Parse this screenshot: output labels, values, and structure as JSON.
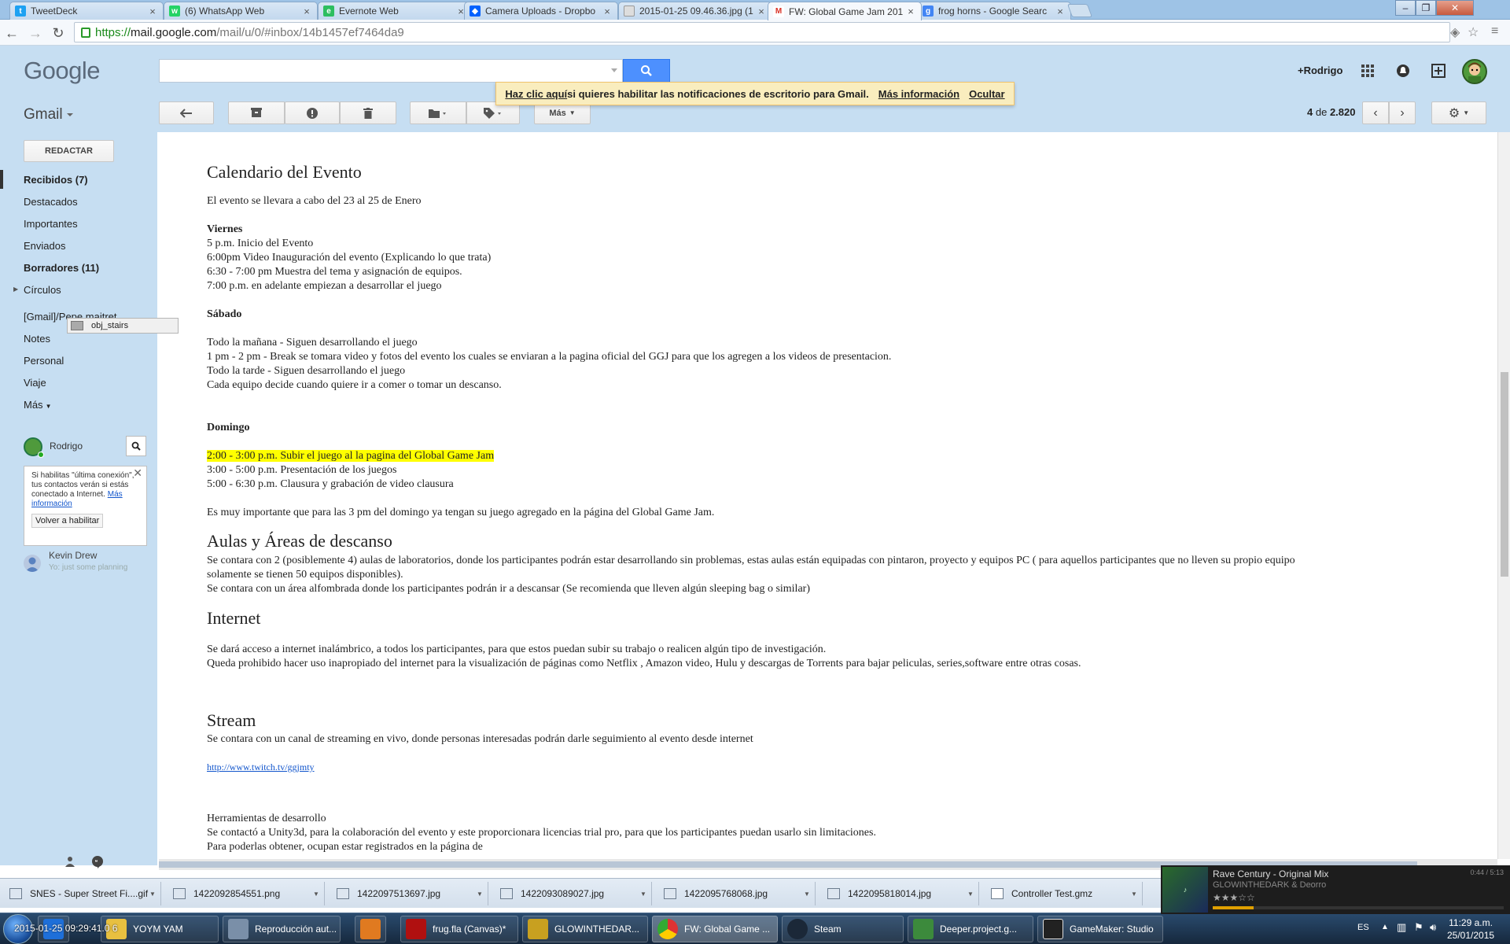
{
  "browser": {
    "tabs": [
      {
        "title": "TweetDeck",
        "icon": "twitter-icon",
        "color": "#1da1f2"
      },
      {
        "title": "(6) WhatsApp Web",
        "icon": "whatsapp-icon",
        "color": "#25d366"
      },
      {
        "title": "Evernote Web",
        "icon": "evernote-icon",
        "color": "#2dbe60"
      },
      {
        "title": "Camera Uploads - Dropbo",
        "icon": "dropbox-icon",
        "color": "#0061fe"
      },
      {
        "title": "2015-01-25 09.46.36.jpg (1",
        "icon": "document-icon",
        "color": "#999999"
      },
      {
        "title": "FW: Global Game Jam 201",
        "icon": "gmail-icon",
        "color": "#d93025"
      },
      {
        "title": "frog horns - Google Searc",
        "icon": "google-icon",
        "color": "#4285f4"
      }
    ],
    "url_scheme": "https://",
    "url_host": "mail.google.com",
    "url_path": "/mail/u/0/#inbox/14b1457ef7464da9"
  },
  "gmail": {
    "logo": "Google",
    "app_label": "Gmail",
    "user": "+Rodrigo",
    "notification": {
      "link": "Haz clic aquí",
      "text": " si quieres habilitar las notificaciones de escritorio para Gmail.",
      "more": "Más información",
      "hide": "Ocultar"
    },
    "more_label": "Más",
    "page_pos": "4",
    "page_of": "de",
    "page_total": "2.820",
    "compose": "REDACTAR",
    "nav": [
      "Recibidos (7)",
      "Destacados",
      "Importantes",
      "Enviados",
      "Borradores (11)",
      "Círculos",
      "[Gmail]/Pepe.maitret...",
      "Notes",
      "Personal",
      "Viaje",
      "Más"
    ],
    "chat_user": "Rodrigo",
    "tooltip": "obj_stairs",
    "chat_popup": {
      "text": "Si habilitas \"última conexión\", tus contactos verán si estás conectado a Internet.",
      "link": "Más información",
      "button": "Volver a habilitar"
    },
    "contact_name": "Kevin Drew",
    "contact_status": "Yo: just some planning"
  },
  "message": {
    "h_calendario": "Calendario del Evento",
    "p_fechas": "El evento se llevara a cabo del 23 al 25 de Enero",
    "viernes": "Viernes",
    "viernes_lines": [
      "5 p.m.  Inicio del Evento",
      "6:00pm  Video Inauguración del evento (Explicando lo que trata)",
      "6:30 -  7:00 pm  Muestra del tema y asignación de equipos.",
      "7:00 p.m. en adelante empiezan a desarrollar el juego"
    ],
    "sabado": "Sábado",
    "sabado_lines": [
      "Todo la mañana - Siguen desarrollando el juego",
      "1 pm - 2 pm -  Break se tomara video y fotos del evento los cuales se enviaran a la pagina oficial del GGJ para que los agregen a los videos de presentacion.",
      "Todo la tarde - Siguen desarrollando el juego",
      "Cada equipo decide cuando quiere ir a comer o tomar un descanso."
    ],
    "domingo": "Domingo",
    "domingo_highlight": "2:00 - 3:00 p.m.  Subir el juego al la pagina del Global Game Jam",
    "domingo_lines": [
      "3:00 - 5:00 p.m.  Presentación de los juegos",
      "5:00 - 6:30 p.m.  Clausura y grabación de video clausura"
    ],
    "p_importante": "Es muy importante que para las 3 pm del domingo ya tengan su juego agregado en la página del Global Game Jam.",
    "h_aulas": "Aulas y Áreas de descanso",
    "aulas_lines": [
      "Se contara con 2 (posiblemente 4) aulas de laboratorios, donde los participantes podrán estar desarrollando sin problemas, estas aulas están equipadas con pintaron, proyecto y equipos PC ( para aquellos participantes que no lleven su propio equipo",
      "solamente se tienen 50 equipos disponibles).",
      "Se contara con un área alfombrada donde los participantes podrán ir a descansar (Se recomienda que lleven algún sleeping bag o similar)"
    ],
    "h_internet": "Internet",
    "internet_lines": [
      "Se dará acceso a internet inalámbrico, a todos los participantes, para que estos puedan subir su trabajo o realicen algún tipo de investigación.",
      "Queda prohibido hacer uso inapropiado  del internet para la visualización de páginas como Netflix , Amazon video, Hulu y descargas de Torrents para bajar peliculas, series,software entre otras cosas."
    ],
    "h_stream": "Stream",
    "stream_line": "Se contara con un canal de streaming en vivo, donde personas interesadas podrán darle seguimiento al evento desde internet",
    "stream_link": "http://www.twitch.tv/ggjmty",
    "herramientas": "Herramientas de desarrollo",
    "herramientas_lines": [
      "Se contactó a Unity3d, para la colaboración del evento y este proporcionara  licencias trial pro, para que los participantes puedan usarlo sin limitaciones.",
      "Para poderlas obtener, ocupan estar registrados en la página de"
    ]
  },
  "downloads": [
    "SNES - Super Street Fi....gif",
    "1422092854551.png",
    "1422097513697.jpg",
    "1422093089027.jpg",
    "1422095768068.jpg",
    "1422095818014.jpg",
    "Controller Test.gmz"
  ],
  "player": {
    "song": "Rave Century - Original Mix",
    "artist": "GLOWINTHEDARK & Deorro",
    "time": "0:44 / 5:13",
    "progress": 0.14,
    "rating_stars": 3,
    "rating_max": 5
  },
  "taskbar": {
    "overlay": "2015-01-25 09:29:41.0 6",
    "items": [
      {
        "label": "YOYM YAM",
        "color": "#e8c040"
      },
      {
        "label": "Reproducción aut...",
        "color": "#7a8fa8"
      },
      {
        "label": "",
        "color": "#e07a20"
      },
      {
        "label": "frug.fla (Canvas)*",
        "color": "#b01010"
      },
      {
        "label": "GLOWINTHEDAR...",
        "color": "#c8a020"
      },
      {
        "label": "FW: Global Game ...",
        "color": "#3a8a3a"
      },
      {
        "label": "Steam",
        "color": "#1b2838"
      },
      {
        "label": "Deeper.project.g...",
        "color": "#3c8a3c"
      },
      {
        "label": "GameMaker: Studio",
        "color": "#222222"
      }
    ],
    "lang": "ES",
    "time": "11:29 a.m.",
    "date": "25/01/2015"
  }
}
